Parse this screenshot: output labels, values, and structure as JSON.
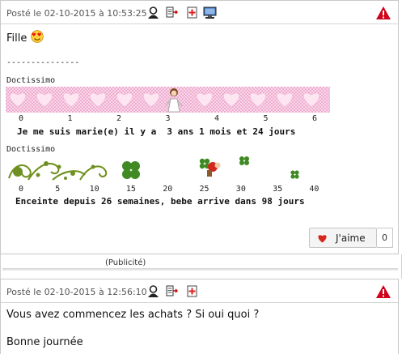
{
  "post1": {
    "meta": "Posté le 02-10-2015 à 10:53:25",
    "greeting": "Fille",
    "separator": "---------------",
    "ticker1": {
      "brand": "Doctissimo",
      "scale": [
        "0",
        "1",
        "2",
        "3",
        "4",
        "5",
        "6"
      ],
      "caption": "Je me suis marie(e) il y a  3 ans 1 mois et 24 jours"
    },
    "ticker2": {
      "brand": "Doctissimo",
      "scale": [
        "0",
        "5",
        "10",
        "15",
        "20",
        "25",
        "30",
        "35",
        "40"
      ],
      "caption": "Enceinte depuis 26 semaines, bebe arrive dans 98 jours"
    },
    "like_label": "J'aime",
    "like_count": "0"
  },
  "ad_label": "(Publicité)",
  "post2": {
    "meta": "Posté le 02-10-2015 à 12:56:10",
    "line1": "Vous avez commencez les achats ? Si oui quoi ?",
    "line2": "Bonne journée"
  },
  "icons": [
    "profile-icon",
    "private-message-icon",
    "add-to-list-icon",
    "computer-icon",
    "report-warning-icon",
    "heart-icon",
    "love-emoji-icon"
  ],
  "colors": {
    "warning_red": "#d0021b",
    "heart_red": "#d9261c",
    "ticker_pink": "#f6c2df",
    "clover_green": "#4c8a2a"
  }
}
